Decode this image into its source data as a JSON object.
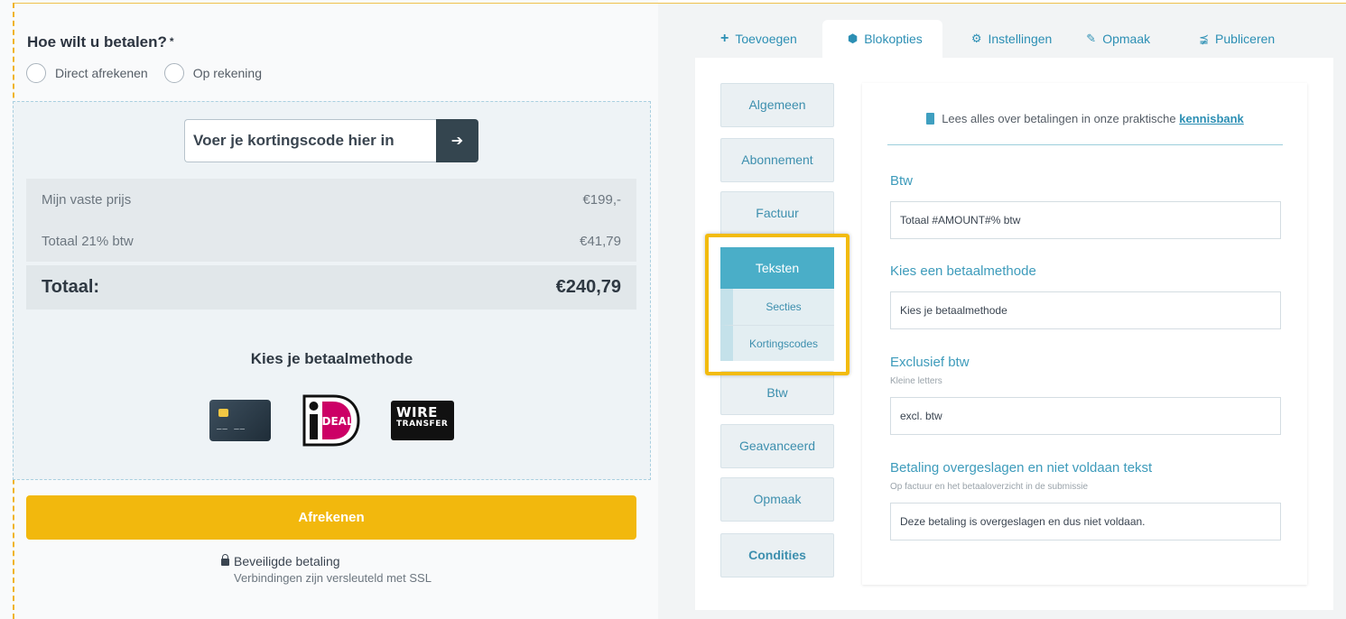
{
  "checkout": {
    "question": "Hoe wilt u betalen?",
    "required_mark": "*",
    "options": [
      {
        "label": "Direct afrekenen"
      },
      {
        "label": "Op rekening"
      }
    ],
    "coupon_placeholder": "Voer je kortingscode hier in",
    "prices": [
      {
        "label": "Mijn vaste prijs",
        "value": "€199,-"
      },
      {
        "label": "Totaal 21% btw",
        "value": "€41,79"
      }
    ],
    "total_label": "Totaal:",
    "total_value": "€240,79",
    "payment_title": "Kies je betaalmethode",
    "payment_methods": [
      "credit-card-icon",
      "ideal-logo",
      "wire-transfer-logo"
    ],
    "ideal_text": "iDEAL",
    "wire_line1": "WIRE",
    "wire_line2": "TRANSFER",
    "checkout_button": "Afrekenen",
    "secure_title": "Beveiligde betaling",
    "secure_subtitle": "Verbindingen zijn versleuteld met SSL"
  },
  "editor": {
    "tabs": [
      {
        "icon": "plus-icon",
        "label": "Toevoegen"
      },
      {
        "icon": "cube-icon",
        "label": "Blokopties"
      },
      {
        "icon": "gear-icon",
        "label": "Instellingen"
      },
      {
        "icon": "brush-icon",
        "label": "Opmaak"
      },
      {
        "icon": "share-icon",
        "label": "Publiceren"
      }
    ],
    "active_tab": "Blokopties",
    "side_menu": {
      "algemeen": "Algemeen",
      "abonnement": "Abonnement",
      "factuur": "Factuur",
      "teksten": "Teksten",
      "secties": "Secties",
      "kortingscodes": "Kortingscodes",
      "btw": "Btw",
      "geavanceerd": "Geavanceerd",
      "opmaak": "Opmaak",
      "condities": "Condities"
    },
    "info_text": "Lees alles over betalingen in onze praktische",
    "info_link": "kennisbank",
    "fields": {
      "btw": {
        "label": "Btw",
        "value": "Totaal #AMOUNT#% btw"
      },
      "betaalmethode": {
        "label": "Kies een betaalmethode",
        "value": "Kies je betaalmethode"
      },
      "exclusief": {
        "label": "Exclusief btw",
        "hint": "Kleine letters",
        "value": "excl. btw"
      },
      "overgeslagen": {
        "label": "Betaling overgeslagen en niet voldaan tekst",
        "hint": "Op factuur en het betaaloverzicht in de submissie",
        "value": "Deze betaling is overgeslagen en dus niet voldaan."
      }
    }
  },
  "colors": {
    "accent": "#2c8fb4",
    "active_menu": "#4aaec8",
    "checkout_button": "#f2b80d",
    "highlight": "#f2bb0e"
  }
}
